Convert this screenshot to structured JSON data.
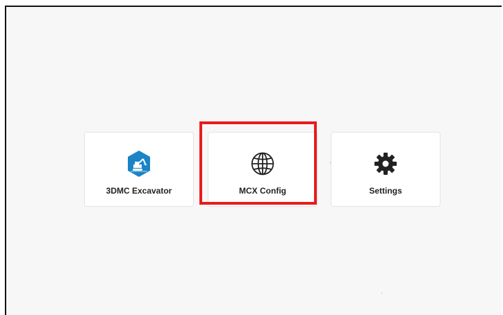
{
  "tiles": [
    {
      "label": "3DMC Excavator",
      "icon": "excavator-icon"
    },
    {
      "label": "MCX Config",
      "icon": "globe-icon"
    },
    {
      "label": "Settings",
      "icon": "gear-icon"
    }
  ],
  "highlight": {
    "target": "MCX Config",
    "color": "#ea1b1b"
  },
  "colors": {
    "background": "#f7f7f7",
    "tile": "#ffffff",
    "excavator_icon": "#1a84c6",
    "text": "#222222"
  }
}
